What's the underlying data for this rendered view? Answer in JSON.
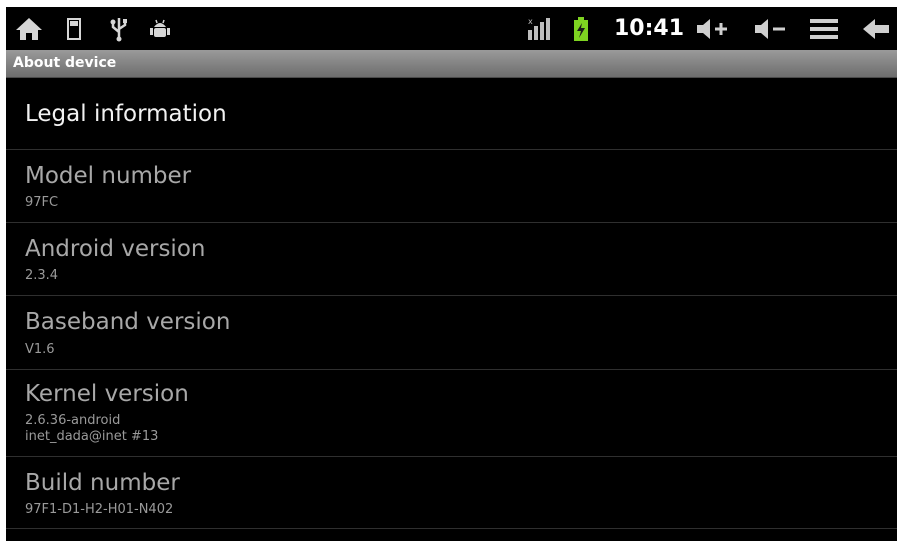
{
  "status_bar": {
    "time": "10:41",
    "left_icons": [
      "home-icon",
      "sd-card-icon",
      "usb-icon",
      "android-debug-icon"
    ],
    "right_icons": [
      "signal-icon",
      "battery-charging-icon",
      "volume-up-icon",
      "volume-down-icon",
      "menu-icon",
      "back-icon"
    ]
  },
  "title_bar": {
    "title": "About device"
  },
  "items": [
    {
      "title": "Legal information"
    },
    {
      "title": "Model number",
      "summary": "97FC"
    },
    {
      "title": "Android version",
      "summary": "2.3.4"
    },
    {
      "title": "Baseband version",
      "summary": "V1.6"
    },
    {
      "title": "Kernel version",
      "summary": "2.6.36-android",
      "summary2": "inet_dada@inet #13"
    },
    {
      "title": "Build number",
      "summary": "97F1-D1-H2-H01-N402"
    }
  ],
  "colors": {
    "background": "#000000",
    "title_bar": "#8a8a8a",
    "battery": "#7ed321"
  }
}
